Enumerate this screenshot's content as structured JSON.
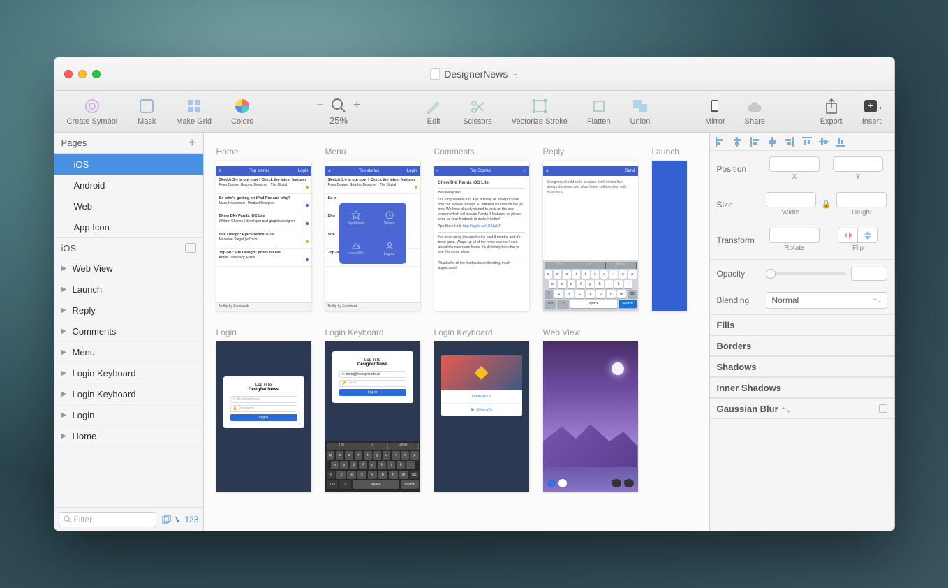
{
  "title": "DesignerNews",
  "toolbar": {
    "createSymbol": "Create Symbol",
    "mask": "Mask",
    "makeGrid": "Make Grid",
    "colors": "Colors",
    "zoom": "25%",
    "edit": "Edit",
    "scissors": "Scissors",
    "vectorize": "Vectorize Stroke",
    "flatten": "Flatten",
    "union": "Union",
    "mirror": "Mirror",
    "share": "Share",
    "export": "Export",
    "insert": "Insert"
  },
  "pages": {
    "header": "Pages",
    "items": [
      {
        "label": "iOS",
        "selected": true
      },
      {
        "label": "Android",
        "selected": false
      },
      {
        "label": "Web",
        "selected": false
      },
      {
        "label": "App Icon",
        "selected": false
      }
    ]
  },
  "layerSection": "iOS",
  "layers": [
    "Web View",
    "Launch",
    "Reply",
    "Comments",
    "Menu",
    "Login Keyboard",
    "Login Keyboard",
    "Login",
    "Home"
  ],
  "filter": {
    "placeholder": "Filter",
    "count": "123"
  },
  "artboards": {
    "row1": [
      "Home",
      "Menu",
      "Comments",
      "Reply",
      "Launch"
    ],
    "row2": [
      "Login",
      "Login Keyboard",
      "Login Keyboard",
      "Web View"
    ]
  },
  "homeboard": {
    "navLeft": "≡",
    "navTitle": "Top stories",
    "navRight": "Login",
    "rows": [
      {
        "t": "Sketch 3.4 is out now ! Check the latest features",
        "m": "From Davies, Graphic Designer | The Digital",
        "c": "#e8a43a"
      },
      {
        "t": "So who's getting an iPad Pro and why?",
        "m": "Mads Kristensen | Product Designer",
        "c": "#3969c8"
      },
      {
        "t": "Show DN: Panda iOS Lite",
        "m": "William Chance | developer and graphic designer",
        "c": "#d13a3a"
      },
      {
        "t": "Site Design: Epicurrence 2016",
        "m": "Madeline Siegal | eZp.co",
        "c": "#e8a43a"
      },
      {
        "t": "Top-50 \"Site Design\" posts on DN",
        "m": "Anton Zastovsky, Editor",
        "c": "#3969c8"
      }
    ],
    "footer": "Notify by Facebook"
  },
  "menuboard": {
    "cells": [
      "Top Stories",
      "Recent",
      "Learn iOS",
      "Logout"
    ]
  },
  "commentsboard": {
    "navTitle": "Top Stories",
    "title": "Show DN: Panda iOS Lite",
    "greeting": "Hey everyone!",
    "body1": "Our long-awaited iOS App is finally on the App Store. You can browse through 50 different sources on the go now. We have already started to work on the next version which will include Panda 4 features, so please send us your feedback to make it better!",
    "linklabel": "App Store Link:",
    "link": "http://apple.co/1O23pGP",
    "body2": "I've been using this app for the past 3 months and it's been great. Wraps up all of the news sources I care about into nice clean feeds. It's definitely been fun to see this come along.",
    "thanks": "Thanks for all the feedbacks and testing, much appreciated!"
  },
  "replyboard": {
    "navRight": "Send",
    "body": "Designers should code because it will inform their design decisions and allow better collaboration with engineers.",
    "sug": [
      "The",
      "Is",
      "Great"
    ]
  },
  "loginboard": {
    "hdr1": "Log in to",
    "hdr2": "Designer News",
    "email": "Email address",
    "pass": "Password",
    "btn": "Log in"
  },
  "loginkb": {
    "emailval": "meng@designcode.io",
    "passval": "•••••••",
    "sug": [
      "The",
      "Is",
      "Great"
    ]
  },
  "loginkb2": {
    "learn": "Learn iOS 9",
    "twitter": "@MengTo"
  },
  "keyboard": {
    "r1": [
      "q",
      "w",
      "e",
      "r",
      "t",
      "y",
      "u",
      "i",
      "o",
      "p"
    ],
    "r2": [
      "a",
      "s",
      "d",
      "f",
      "g",
      "h",
      "j",
      "k",
      "l"
    ],
    "r3": [
      "⇧",
      "z",
      "x",
      "c",
      "v",
      "b",
      "n",
      "m",
      "⌫"
    ],
    "r4": [
      "123",
      "☺",
      "space",
      "Search"
    ]
  },
  "inspector": {
    "position": "Position",
    "x": "X",
    "y": "Y",
    "size": "Size",
    "width": "Width",
    "height": "Height",
    "transform": "Transform",
    "rotate": "Rotate",
    "flip": "Flip",
    "opacity": "Opacity",
    "blending": "Blending",
    "blendval": "Normal",
    "sections": [
      "Fills",
      "Borders",
      "Shadows",
      "Inner Shadows",
      "Gaussian Blur"
    ]
  }
}
